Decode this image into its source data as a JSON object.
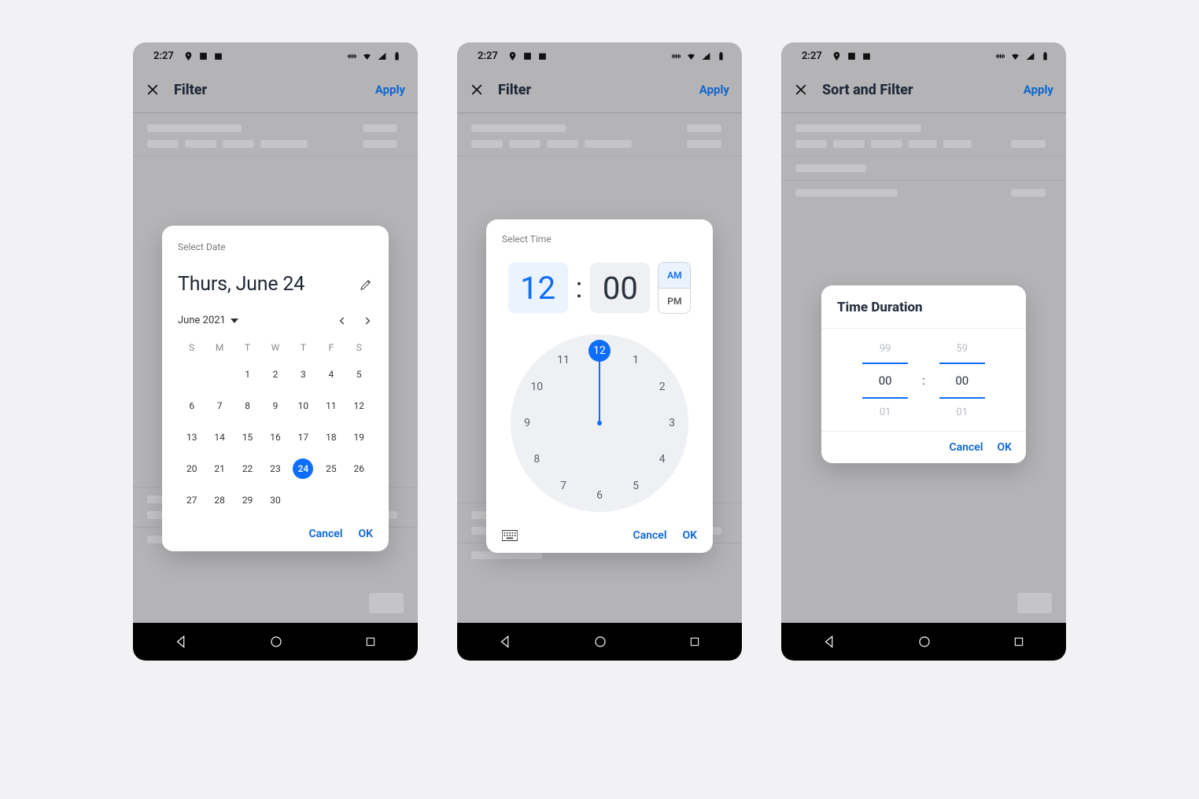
{
  "status": {
    "time": "2:27"
  },
  "phone1": {
    "appbar": {
      "title": "Filter",
      "apply": "Apply"
    },
    "date": {
      "label": "Select Date",
      "headline": "Thurs, June 24",
      "month": "June 2021",
      "weekdays": [
        "S",
        "M",
        "T",
        "W",
        "T",
        "F",
        "S"
      ],
      "first_day_index": 2,
      "days_in_month": 30,
      "selected_day": 24,
      "cancel": "Cancel",
      "ok": "OK"
    }
  },
  "phone2": {
    "appbar": {
      "title": "Filter",
      "apply": "Apply"
    },
    "time": {
      "label": "Select Time",
      "hour": "12",
      "minute": "00",
      "ampm": {
        "am": "AM",
        "pm": "PM",
        "selected": "AM"
      },
      "clock_numbers": [
        "12",
        "1",
        "2",
        "3",
        "4",
        "5",
        "6",
        "7",
        "8",
        "9",
        "10",
        "11"
      ],
      "selected_index": 0,
      "cancel": "Cancel",
      "ok": "OK"
    }
  },
  "phone3": {
    "appbar": {
      "title": "Sort and Filter",
      "apply": "Apply"
    },
    "duration": {
      "title": "Time Duration",
      "hour": {
        "prev": "99",
        "value": "00",
        "next": "01"
      },
      "minute": {
        "prev": "59",
        "value": "00",
        "next": "01"
      },
      "cancel": "Cancel",
      "ok": "OK"
    }
  }
}
